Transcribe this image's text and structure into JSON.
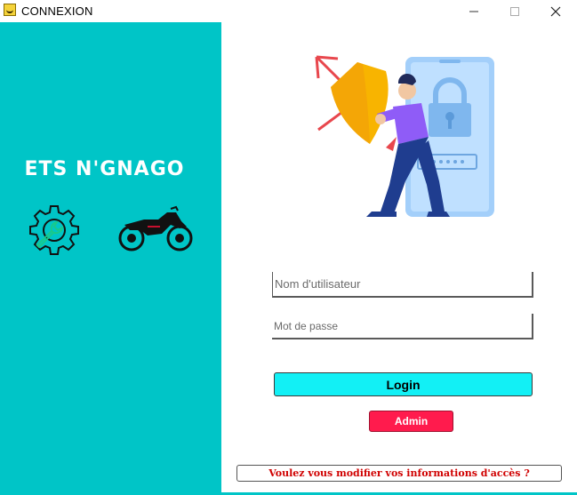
{
  "window": {
    "title": "CONNEXION",
    "controls": {
      "minimize": "—",
      "maximize": "☐",
      "close": "✕"
    }
  },
  "sidebar": {
    "company_name": "ETS N'GNAGO",
    "icons": [
      "gear-wrench-icon",
      "motorcycle-icon"
    ]
  },
  "hero": {
    "illustration": "security-shield-phone-illustration"
  },
  "form": {
    "username_placeholder": "Nom d'utilisateur",
    "username_value": "",
    "password_placeholder": "Mot de passe",
    "password_value": "",
    "login_label": "Login",
    "admin_label": "Admin",
    "modify_label": "Voulez vous modifier vos informations d'accès ?"
  },
  "colors": {
    "sidebar": "#00c5c7",
    "login_button": "#12f0f5",
    "admin_button": "#ff1b4d",
    "modify_text": "#d00000"
  }
}
